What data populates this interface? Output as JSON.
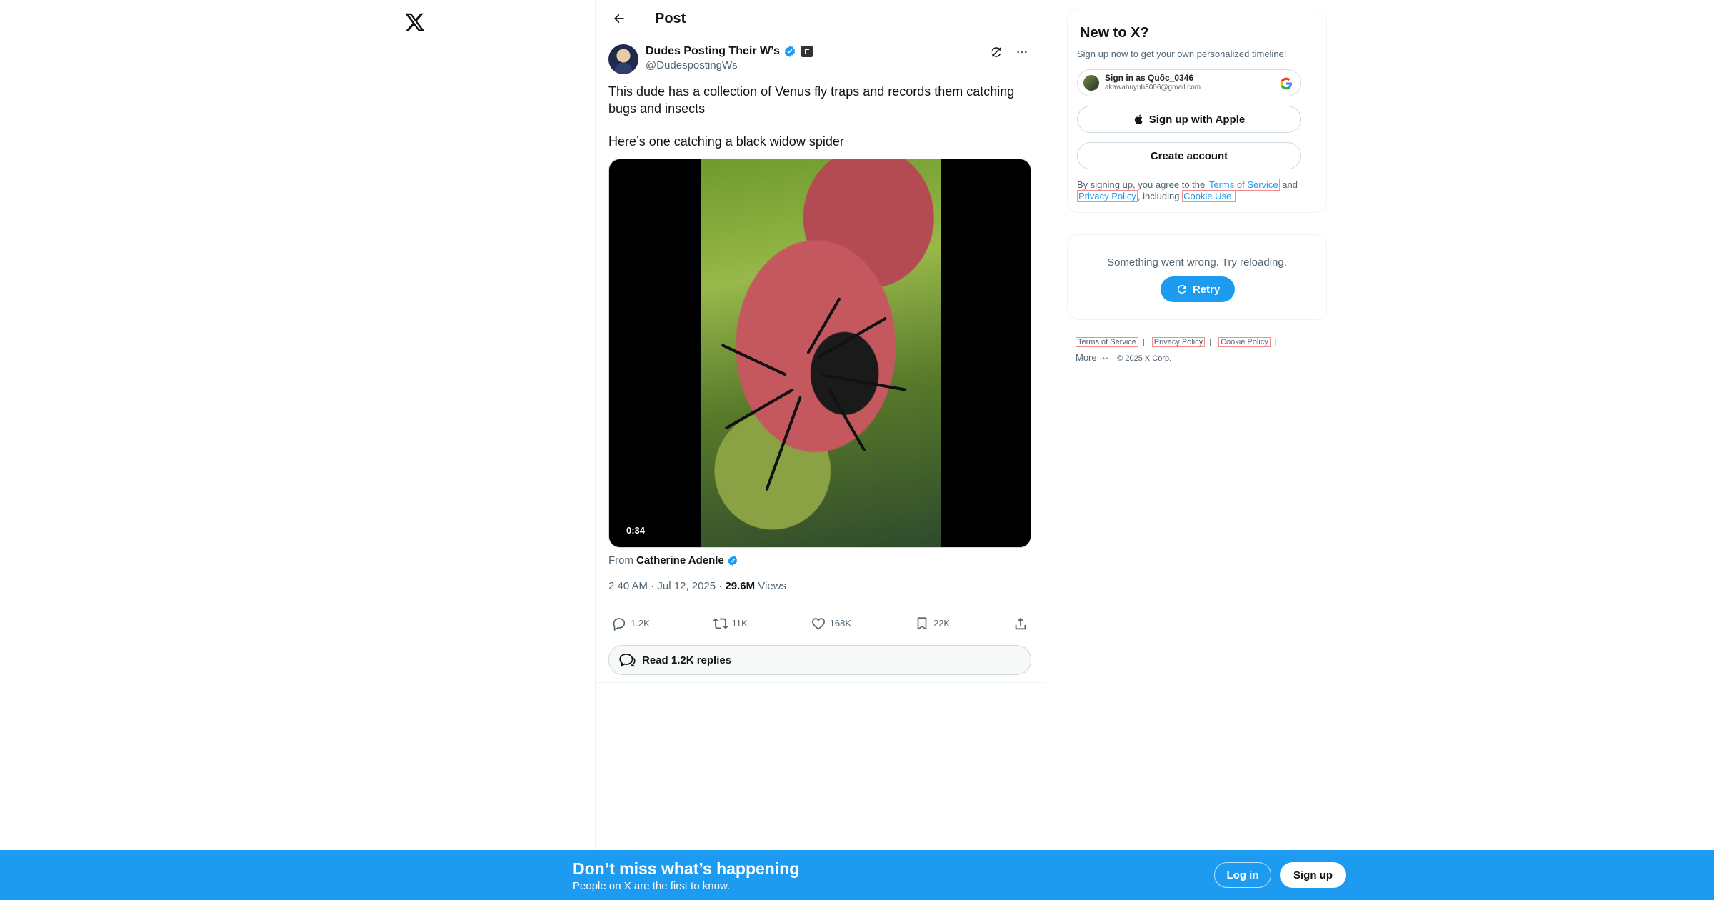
{
  "header": {
    "title": "Post"
  },
  "post": {
    "author_name": "Dudes Posting Their W’s",
    "author_handle": "@DudespostingWs",
    "text_line1": "This dude has a collection of Venus fly traps and records them catching bugs and insects",
    "text_line2": "Here’s one catching a black widow spider",
    "video_duration": "0:34",
    "from_prefix": "From",
    "from_name": "Catherine Adenle",
    "timestamp": "2:40 AM · Jul 12, 2025 · ",
    "views_count": "29.6M",
    "views_label": " Views",
    "replies": "1.2K",
    "reposts": "11K",
    "likes": "168K",
    "bookmarks": "22K",
    "read_replies": "Read 1.2K replies"
  },
  "sidebar": {
    "title": "New to X?",
    "subtitle": "Sign up now to get your own personalized timeline!",
    "google_line1": "Sign in as Quốc_0346",
    "google_line2": "akawahuynh3006@gmail.com",
    "apple_label": "Sign up with Apple",
    "create_label": "Create account",
    "legal_prefix": "By signing up, you agree to the ",
    "legal_terms": "Terms of Service",
    "legal_and": " and ",
    "legal_privacy": "Privacy Policy",
    "legal_including": ", including ",
    "legal_cookie": "Cookie Use.",
    "error_text": "Something went wrong. Try reloading.",
    "retry_label": "Retry"
  },
  "footer": {
    "terms": "Terms of Service",
    "privacy": "Privacy Policy",
    "cookie": "Cookie Policy",
    "sep": "|",
    "more": "More ···",
    "copyright": "© 2025 X Corp."
  },
  "banner": {
    "title": "Don’t miss what’s happening",
    "subtitle": "People on X are the first to know.",
    "login_label": "Log in",
    "signup_label": "Sign up"
  },
  "colors": {
    "accent": "#1d9bf0",
    "text": "#0f1419",
    "muted": "#536471"
  }
}
